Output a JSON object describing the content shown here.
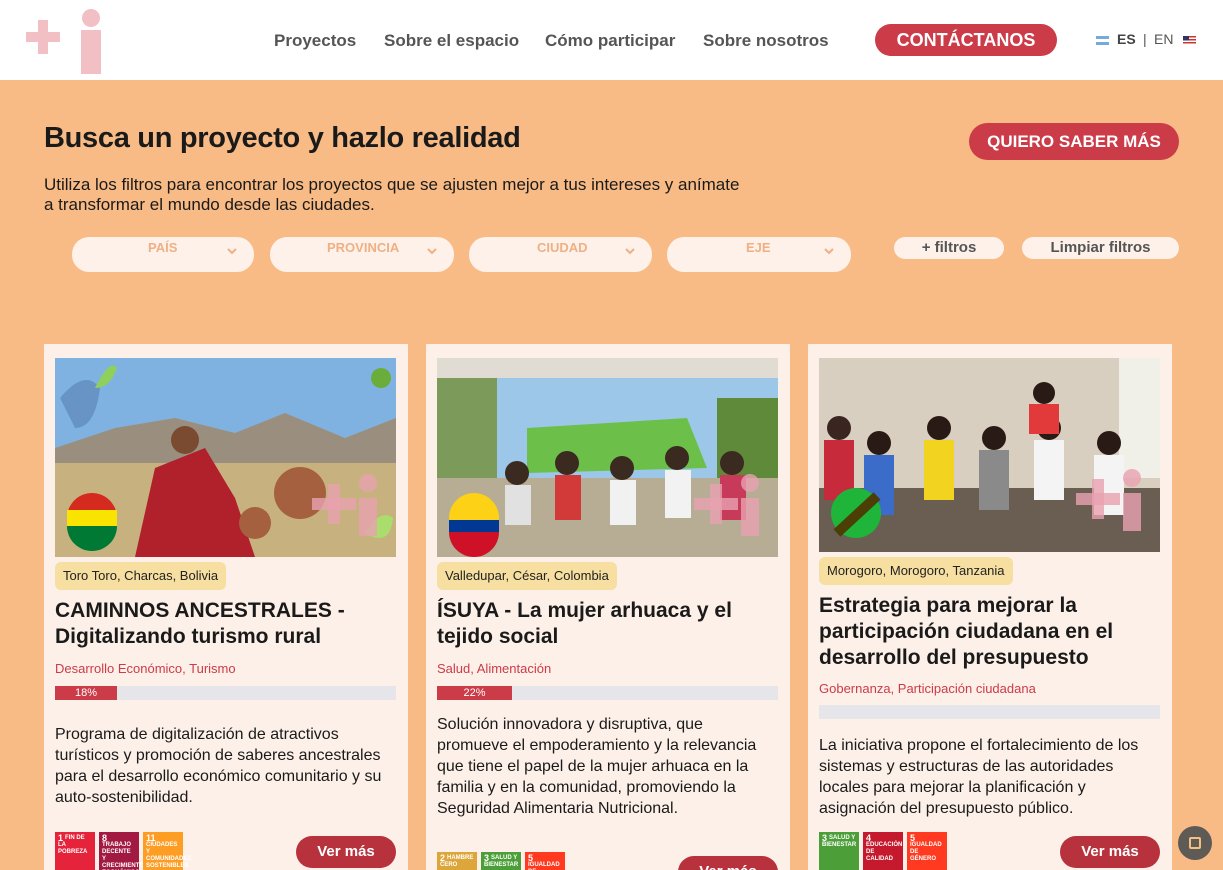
{
  "nav": {
    "items": [
      "Proyectos",
      "Sobre el espacio",
      "Cómo participar",
      "Sobre nosotros"
    ],
    "contact": "CONTÁCTANOS",
    "lang_es": "ES",
    "lang_sep": "|",
    "lang_en": "EN"
  },
  "hero": {
    "title": "Busca un proyecto y hazlo realidad",
    "button": "QUIERO SABER MÁS",
    "description": "Utiliza los filtros para encontrar los proyectos que se ajusten mejor a tus intereses y anímate a transformar el mundo desde las ciudades."
  },
  "filters": {
    "pais": "PAÍS",
    "provincia": "PROVINCIA",
    "ciudad": "CIUDAD",
    "eje": "EJE",
    "more": "+ filtros",
    "clear": "Limpiar filtros"
  },
  "cards": [
    {
      "location": "Toro Toro, Charcas, Bolivia",
      "title": "CAMINNOS ANCESTRALES - Digitalizando turismo rural",
      "tags": "Desarrollo Económico, Turismo",
      "progress_label": "18%",
      "progress": 0.18,
      "description": "Programa de digitalización de atractivos turísticos y promoción de saberes ancestrales para el desarrollo económico comunitario y su auto-sostenibilidad.",
      "ods": [
        {
          "num": "1",
          "label": "FIN DE LA POBREZA",
          "color": "#e5243b"
        },
        {
          "num": "8",
          "label": "TRABAJO DECENTE Y CRECIMIENTO ECONÓMICO",
          "color": "#a21942"
        },
        {
          "num": "11",
          "label": "CIUDADES Y COMUNIDADES SOSTENIBLES",
          "color": "#fd9d24"
        }
      ],
      "button": "Ver más"
    },
    {
      "location": "Valledupar, César, Colombia",
      "title": "ÍSUYA - La mujer arhuaca y el tejido social",
      "tags": "Salud, Alimentación",
      "progress_label": "22%",
      "progress": 0.22,
      "description": "Solución innovadora y disruptiva, que promueve el empoderamiento y la relevancia que tiene el papel de la mujer arhuaca en la familia y en la comunidad, promoviendo la Seguridad Alimentaria Nutricional.",
      "ods": [
        {
          "num": "2",
          "label": "HAMBRE CERO",
          "color": "#dda63a"
        },
        {
          "num": "3",
          "label": "SALUD Y BIENESTAR",
          "color": "#4c9f38"
        },
        {
          "num": "5",
          "label": "IGUALDAD DE GÉNERO",
          "color": "#ff3a21"
        }
      ],
      "button": "Ver más"
    },
    {
      "location": "Morogoro, Morogoro, Tanzania",
      "title": "Estrategia para mejorar la participación ciudadana en el desarrollo del presupuesto",
      "tags": "Gobernanza, Participación ciudadana",
      "progress": 0,
      "description": "La iniciativa propone el fortalecimiento de los sistemas y estructuras de las autoridades locales para mejorar la planificación y asignación del presupuesto público.",
      "ods": [
        {
          "num": "3",
          "label": "SALUD Y BIENESTAR",
          "color": "#4c9f38"
        },
        {
          "num": "4",
          "label": "EDUCACIÓN DE CALIDAD",
          "color": "#c5192d"
        },
        {
          "num": "5",
          "label": "IGUALDAD DE GÉNERO",
          "color": "#ff3a21"
        }
      ],
      "button": "Ver más"
    }
  ],
  "colors": {
    "accent": "#cc3b48",
    "background": "#f8bb85",
    "card": "#fdf0e8",
    "location_chip": "#f6dfa0"
  }
}
